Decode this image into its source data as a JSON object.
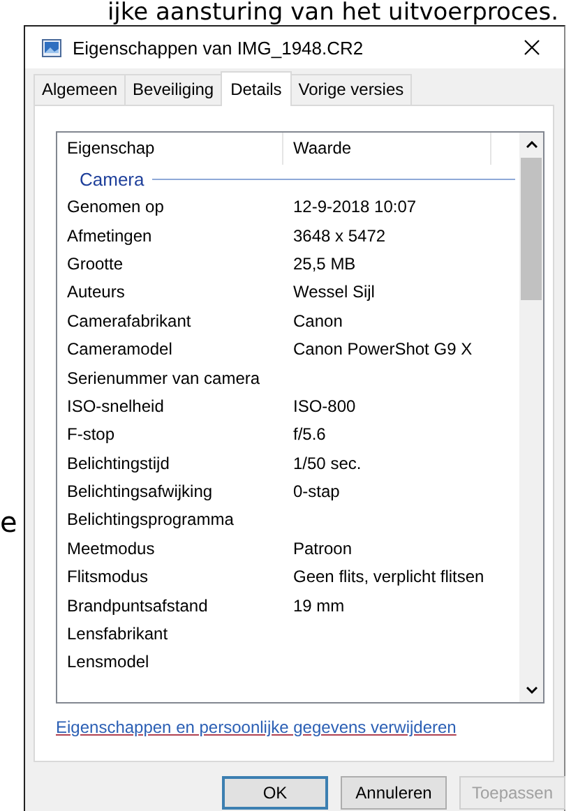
{
  "background_text": {
    "top_line": "ijke aansturing van het uitvoerproces.",
    "side_letter": "e"
  },
  "window": {
    "title": "Eigenschappen van IMG_1948.CR2"
  },
  "tabs": [
    {
      "label": "Algemeen",
      "selected": false
    },
    {
      "label": "Beveiliging",
      "selected": false
    },
    {
      "label": "Details",
      "selected": true
    },
    {
      "label": "Vorige versies",
      "selected": false
    }
  ],
  "property_list": {
    "columns": [
      "Eigenschap",
      "Waarde"
    ],
    "group": "Camera",
    "rows": [
      {
        "property": "Genomen op",
        "value": "12-9-2018 10:07"
      },
      {
        "property": "Afmetingen",
        "value": "3648 x 5472"
      },
      {
        "property": "Grootte",
        "value": "25,5 MB"
      },
      {
        "property": "Auteurs",
        "value": "Wessel Sijl"
      },
      {
        "property": "Camerafabrikant",
        "value": "Canon"
      },
      {
        "property": "Cameramodel",
        "value": "Canon PowerShot G9 X"
      },
      {
        "property": "Serienummer van camera"
      },
      {
        "property": "ISO-snelheid",
        "value": "ISO-800"
      },
      {
        "property": "F-stop",
        "value": "f/5.6"
      },
      {
        "property": "Belichtingstijd",
        "value": "1/50 sec."
      },
      {
        "property": "Belichtingsafwijking",
        "value": "0-stap"
      },
      {
        "property": "Belichtingsprogramma"
      },
      {
        "property": "Meetmodus",
        "value": "Patroon"
      },
      {
        "property": "Flitsmodus",
        "value": "Geen flits, verplicht flitsen"
      },
      {
        "property": "Brandpuntsafstand",
        "value": "19 mm"
      },
      {
        "property": "Lensfabrikant"
      },
      {
        "property": "Lensmodel"
      }
    ]
  },
  "link": "Eigenschappen en persoonlijke gegevens verwijderen",
  "buttons": [
    {
      "label": "OK",
      "default": true,
      "disabled": false
    },
    {
      "label": "Annuleren",
      "default": false,
      "disabled": false
    },
    {
      "label": "Toepassen",
      "default": false,
      "disabled": true
    }
  ]
}
